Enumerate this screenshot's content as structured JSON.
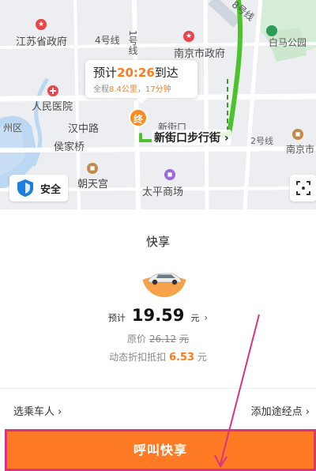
{
  "map": {
    "labels": {
      "jiangsu_gov": "江苏省政府",
      "line4": "4号线",
      "line1": "1号线",
      "nanjing_gov": "南京市政府",
      "baima_park": "白马公园",
      "renmin_hospital": "人民医院",
      "hanzhong_rd": "汉中路",
      "houjiaqiao": "侯家桥",
      "xinjiekou_station": "新街口",
      "line2": "2号线",
      "nanjing_sta": "南京市",
      "chaotiangong": "朝天宫",
      "taiping_mall": "太平商场",
      "ring": "8号线",
      "hangzhou": "州区",
      "nanjing_ring": "南京"
    },
    "bubble": {
      "prefix": "预计",
      "time": "20:26",
      "suffix": "到达",
      "sub_prefix": "全程",
      "distance": "8.4公里",
      "sep": "，",
      "duration": "17分钟"
    },
    "end_marker": "终",
    "destination": "新街口步行街 ›",
    "safety_label": "安全"
  },
  "ride": {
    "car_type": "快享",
    "price_label": "预计",
    "price": "19.59",
    "price_unit": "元",
    "price_chevron": "›",
    "orig_label": "原价",
    "orig_price": "26.12",
    "orig_unit": "元",
    "discount_label": "动态折扣抵扣",
    "discount_value": "6.53",
    "discount_unit": "元"
  },
  "options": {
    "passenger": "选乘车人 ›",
    "waypoint": "添加途经点 ›"
  },
  "call_button": "呼叫快享",
  "colors": {
    "accent": "#ff7a25",
    "route": "#4cc32d",
    "annotation": "#d9347e"
  }
}
